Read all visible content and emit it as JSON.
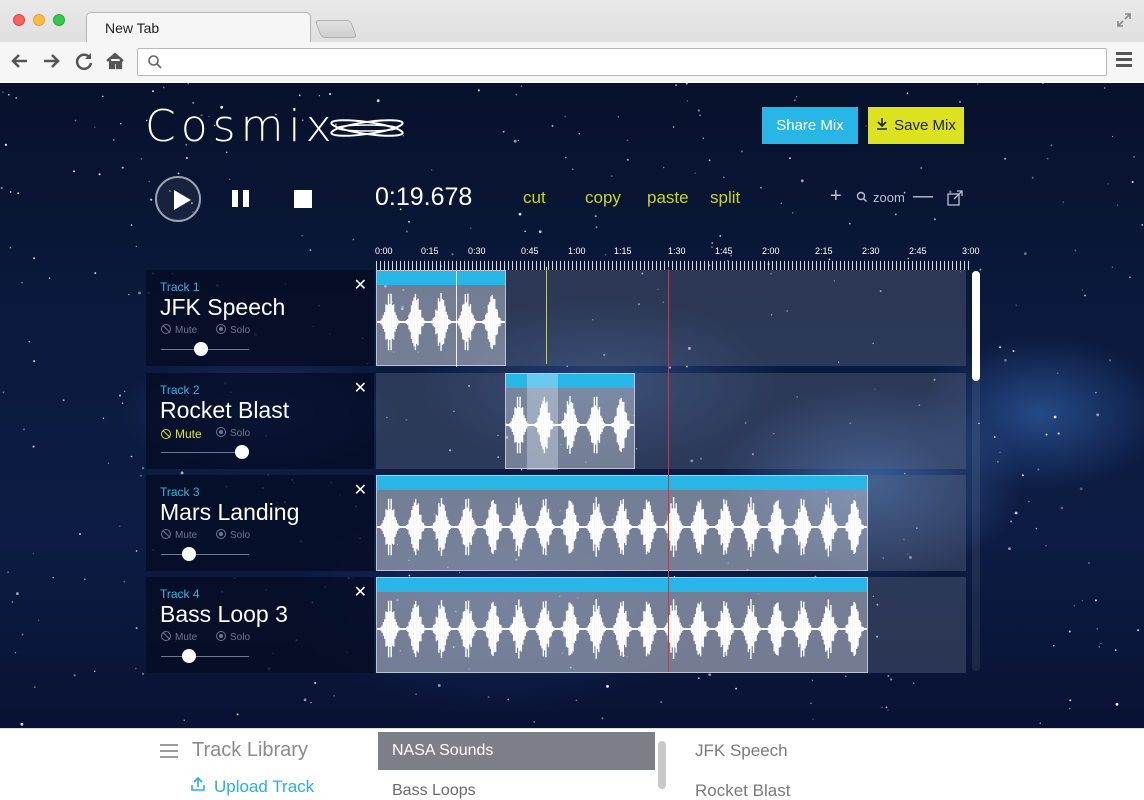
{
  "browser": {
    "tab_title": "New Tab",
    "url": ""
  },
  "app": {
    "logo_text": "Cosmix",
    "share_label": "Share Mix",
    "save_label": "Save Mix",
    "time": "0:19.678",
    "edit_actions": [
      "cut",
      "copy",
      "paste",
      "split"
    ],
    "zoom_label": "zoom",
    "accent_blue": "#27b6e6",
    "accent_yellow": "#dce21d"
  },
  "ruler": [
    "0:00",
    "0:15",
    "0:30",
    "0:45",
    "1:00",
    "1:15",
    "1:30",
    "1:45",
    "2:00",
    "2:15",
    "2:30",
    "2:45",
    "3:00"
  ],
  "tracks": [
    {
      "number": "Track 1",
      "name": "JFK Speech",
      "mute": "Mute",
      "solo": "Solo",
      "muted": false,
      "volume": 0.45
    },
    {
      "number": "Track 2",
      "name": "Rocket Blast",
      "mute": "Mute",
      "solo": "Solo",
      "muted": true,
      "volume": 0.92
    },
    {
      "number": "Track 3",
      "name": "Mars Landing",
      "mute": "Mute",
      "solo": "Solo",
      "muted": false,
      "volume": 0.32
    },
    {
      "number": "Track 4",
      "name": "Bass Loop 3",
      "mute": "Mute",
      "solo": "Solo",
      "muted": false,
      "volume": 0.32
    }
  ],
  "library": {
    "title": "Track Library",
    "upload_label": "Upload Track",
    "categories": [
      "NASA Sounds",
      "Bass Loops"
    ],
    "selected_category": "NASA Sounds",
    "items": [
      "JFK Speech",
      "Rocket Blast"
    ]
  }
}
